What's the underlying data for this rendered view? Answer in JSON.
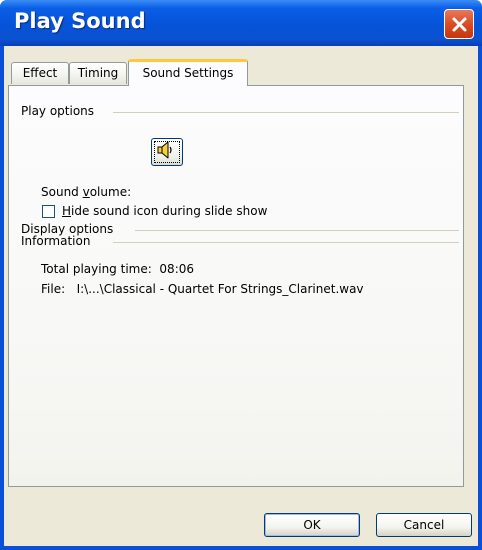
{
  "window": {
    "title": "Play Sound"
  },
  "tabs": [
    {
      "label": "Effect",
      "active": false
    },
    {
      "label": "Timing",
      "active": false
    },
    {
      "label": "Sound Settings",
      "active": true
    }
  ],
  "play_options": {
    "heading": "Play options",
    "volume_label_pre": "Sound ",
    "volume_label_mnemonic": "v",
    "volume_label_post": "olume:",
    "volume_icon": "speaker-icon"
  },
  "display_options": {
    "heading": "Display options",
    "hide_icon_mnemonic": "H",
    "hide_icon_rest": "ide sound icon during slide show",
    "hide_icon_checked": false
  },
  "information": {
    "heading": "Information",
    "total_time_label": "Total playing time:",
    "total_time_value": "08:06",
    "file_label": "File:",
    "file_value": "I:\\...\\Classical - Quartet For Strings_Clarinet.wav"
  },
  "buttons": {
    "ok": "OK",
    "cancel": "Cancel"
  },
  "colors": {
    "titlebar": "#0553d8",
    "close": "#d9491f",
    "dialog_bg": "#ece9d8",
    "active_tab_accent": "#ffc83c"
  }
}
